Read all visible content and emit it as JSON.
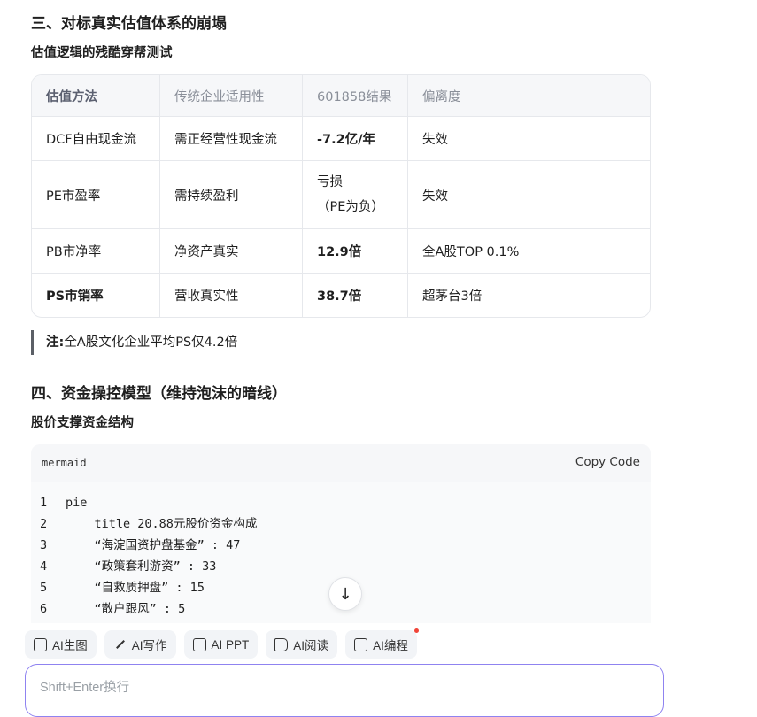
{
  "section3": {
    "title": "三、对标真实估值体系的崩塌",
    "subtitle": "估值逻辑的残酷穿帮测试"
  },
  "valuation_table": {
    "headers": [
      "估值方法",
      "传统企业适用性",
      "601858结果",
      "偏离度"
    ],
    "rows": [
      {
        "method": "DCF自由现金流",
        "applicability": "需正经营性现金流",
        "result": "-7.2亿/年",
        "deviation": "失效"
      },
      {
        "method": "PE市盈率",
        "applicability": "需持续盈利",
        "result_line1": "亏损",
        "result_line2": "（PE为负）",
        "deviation": "失效"
      },
      {
        "method": "PB市净率",
        "applicability": "净资产真实",
        "result": "12.9倍",
        "deviation": "全A股TOP 0.1%"
      },
      {
        "method": "PS市销率",
        "applicability": "营收真实性",
        "result": "38.7倍",
        "deviation": "超茅台3倍"
      }
    ]
  },
  "note": {
    "label": "注:",
    "text": "全A股文化企业平均PS仅4.2倍"
  },
  "section4": {
    "title": "四、资金操控模型（维持泡沫的暗线）",
    "subtitle": "股价支撑资金结构"
  },
  "code_block": {
    "language": "mermaid",
    "copy_label": "Copy Code",
    "lines": [
      "pie",
      "    title 20.88元股价资金构成",
      "    “海淀国资护盘基金” : 47",
      "    “政策套利游资” : 33",
      "    “自救质押盘” : 15",
      "    “散户跟风” : 5"
    ],
    "line_numbers": [
      "1",
      "2",
      "3",
      "4",
      "5",
      "6"
    ]
  },
  "scroll_button": {
    "icon": "arrow-down-icon",
    "glyph": "↓"
  },
  "toolbar": {
    "chips": [
      {
        "label": "AI生图",
        "icon": "image-icon"
      },
      {
        "label": "AI写作",
        "icon": "pen-icon"
      },
      {
        "label": "AI PPT",
        "icon": "ppt-icon"
      },
      {
        "label": "AI阅读",
        "icon": "book-icon"
      },
      {
        "label": "AI编程",
        "icon": "code-icon"
      }
    ]
  },
  "input": {
    "placeholder": "Shift+Enter换行"
  },
  "colors": {
    "accent_border": "#8f83f0",
    "badge_dot": "#f04438"
  }
}
